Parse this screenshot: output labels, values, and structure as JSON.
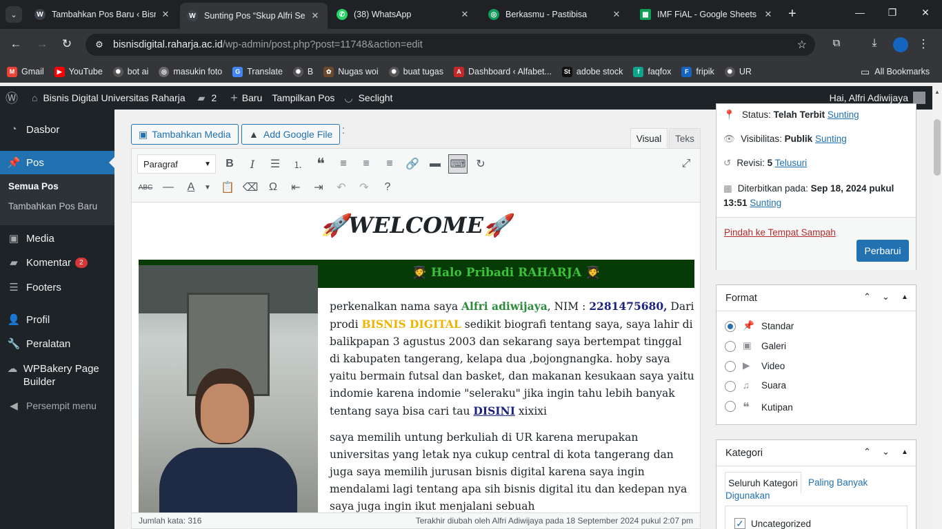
{
  "browser": {
    "tabs": [
      {
        "title": "Tambahkan Pos Baru ‹ Bisn",
        "icon": "wp-icon",
        "color": "#3c434a"
      },
      {
        "title": "Sunting Pos “Skup Alfri Se",
        "icon": "wp-icon",
        "color": "#3c434a"
      },
      {
        "title": "(38) WhatsApp",
        "icon": "whatsapp-icon",
        "color": "#25d366"
      },
      {
        "title": "Berkasmu - Pastibisa",
        "icon": "globe-icon",
        "color": "#0f9d58"
      },
      {
        "title": "IMF FiAL - Google Sheets",
        "icon": "sheets-icon",
        "color": "#0f9d58"
      }
    ],
    "url_host": "bisnisdigital.raharja.ac.id",
    "url_path": "/wp-admin/post.php?post=11748&action=edit",
    "bookmarks": [
      "Gmail",
      "YouTube",
      "bot ai",
      "masukin  foto",
      "Translate",
      "B",
      "Nugas woi",
      "buat tugas",
      "Dashboard ‹ Alfabet...",
      "adobe stock",
      "faqfox",
      "fripik",
      "UR"
    ],
    "all_bookmarks": "All Bookmarks"
  },
  "adminbar": {
    "site": "Bisnis Digital Universitas Raharja",
    "comments": "2",
    "new": "Baru",
    "view": "Tampilkan Pos",
    "plugin": "Seclight",
    "greeting": "Hai, Alfri Adiwijaya"
  },
  "sidebar": {
    "items": [
      "Dasbor",
      "Pos",
      "Media",
      "Komentar",
      "Footers",
      "Profil",
      "Peralatan",
      "WPBakery Page Builder",
      "Persempit menu"
    ],
    "sub": [
      "Semua Pos",
      "Tambahkan Pos Baru"
    ],
    "comment_badge": "2"
  },
  "editor": {
    "add_media": "Tambahkan Media",
    "add_google": "Add Google File",
    "tab_visual": "Visual",
    "tab_text": "Teks",
    "format_select": "Paragraf",
    "welcome": "WELCOME",
    "banner": "Halo Pribadi RAHARJA",
    "p1_a": "perkenalkan nama saya ",
    "p1_name": "Alfri adiwijaya",
    "p1_b": ", NIM : ",
    "p1_nim": "2281475680,",
    "p1_c": " Dari prodi ",
    "p1_prodi": "BISNIS DIGITAL",
    "p1_d": " sedikit biografi tentang saya, saya lahir di balikpapan 3 agustus 2003 dan sekarang saya bertempat tinggal di kabupaten tangerang, kelapa dua ,bojongnangka. hoby saya yaitu bermain futsal dan basket, dan makanan kesukaan saya yaitu indomie karena indomie \"seleraku\" jika ingin tahu lebih banyak tentang saya bisa cari tau ",
    "p1_link": "DISINI",
    "p1_e": " xixixi",
    "p2": "saya memilih untung berkuliah di UR karena merupakan universitas yang letak nya cukup central di kota tangerang dan juga saya memilih jurusan bisnis digital karena saya ingin mendalami lagi tentang apa sih bisnis digital itu dan kedepan nya saya juga ingin ikut menjalani sebuah",
    "word_count": "Jumlah kata: 316",
    "last_edit": "Terakhir diubah oleh Alfri Adiwijaya pada 18 September 2024 pukul 2:07 pm"
  },
  "publish": {
    "status_label": "Status: ",
    "status_value": "Telah Terbit",
    "edit": "Sunting",
    "visibility_label": "Visibilitas: ",
    "visibility_value": "Publik",
    "revisions_label": "Revisi: ",
    "revisions_value": "5",
    "revisions_link": "Telusuri",
    "published_label": "Diterbitkan pada: ",
    "published_value": "Sep 18, 2024 pukul 13:51",
    "trash": "Pindah ke Tempat Sampah",
    "update": "Perbarui"
  },
  "format": {
    "title": "Format",
    "options": [
      "Standar",
      "Galeri",
      "Video",
      "Suara",
      "Kutipan"
    ],
    "selected": "Standar"
  },
  "category": {
    "title": "Kategori",
    "tab_all": "Seluruh Kategori",
    "tab_popular": "Paling Banyak Digunakan",
    "first_item": "Uncategorized"
  },
  "colors": {
    "accent": "#2271b1",
    "admin_dark": "#1d2327",
    "name_green": "#2e8b3a",
    "nim_navy": "#1a237e",
    "prodi_gold": "#f0b400",
    "banner_bg": "#063a06",
    "banner_text": "#3dc13d"
  }
}
